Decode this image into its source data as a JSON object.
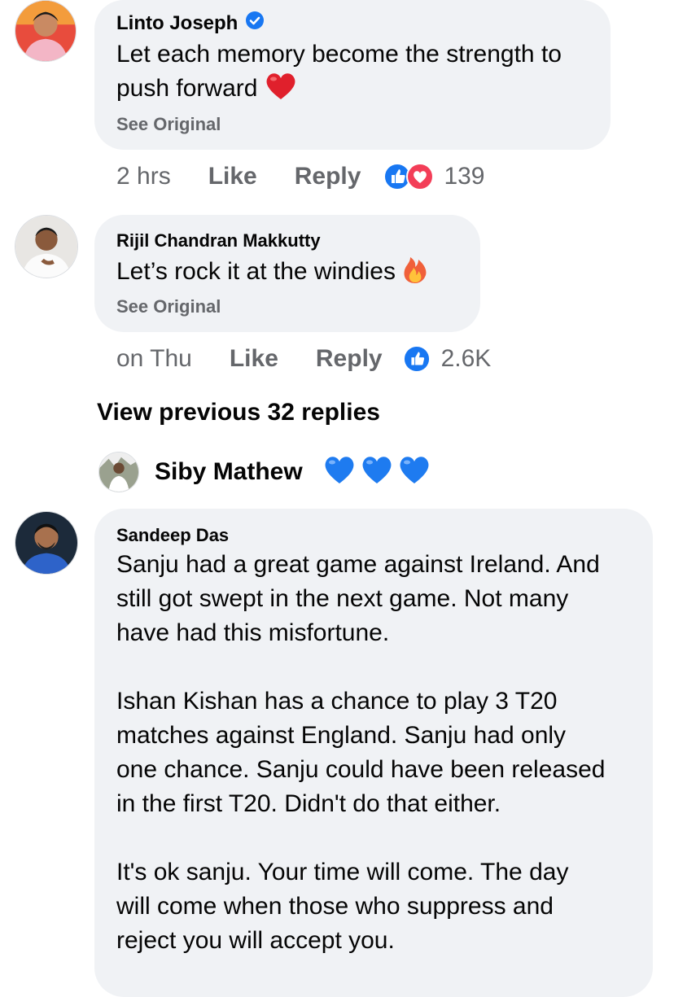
{
  "comments": [
    {
      "author": "Linto Joseph",
      "verified": true,
      "text": "Let each memory become the strength to\npush forward",
      "emoji": "red-heart",
      "see_original": "See Original",
      "time": "2 hrs",
      "like_label": "Like",
      "reply_label": "Reply",
      "reactions": [
        "like",
        "love"
      ],
      "reaction_count": "139"
    },
    {
      "author": "Rijil Chandran Makkutty",
      "verified": false,
      "text": "Let’s rock it at the windies",
      "emoji": "fire",
      "see_original": "See Original",
      "time": "on Thu",
      "like_label": "Like",
      "reply_label": "Reply",
      "reactions": [
        "like"
      ],
      "reaction_count": "2.6K"
    }
  ],
  "view_previous": "View previous 32 replies",
  "reply_preview": {
    "author": "Siby Mathew",
    "emojis": [
      "blue-heart",
      "blue-heart",
      "blue-heart"
    ]
  },
  "main_comment": {
    "author": "Sandeep Das",
    "text": "Sanju had a great game against Ireland. And\nstill got swept in the next game. Not many\nhave had this misfortune.\n\nIshan Kishan has a chance to play 3 T20\nmatches against England. Sanju had only\none chance. Sanju could have been released\nin the first T20. Didn't do that either.\n\nIt's ok sanju. Your time will come. The day\nwill come when those who suppress and\nreject you will accept you."
  },
  "colors": {
    "bubble": "#f0f2f5",
    "meta_text": "#65676b",
    "like_blue": "#1877f2",
    "love_red": "#f33e58",
    "verified_blue": "#1877f2",
    "blue_heart": "#1e7bf0"
  }
}
